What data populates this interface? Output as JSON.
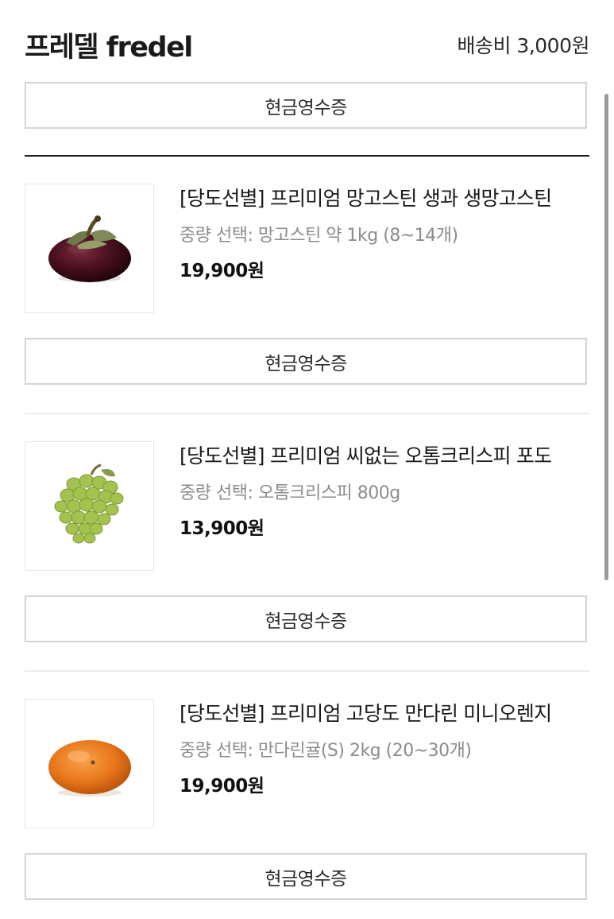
{
  "header": {
    "shop_name": "프레델 fredel",
    "shipping_fee": "배송비 3,000원"
  },
  "receipt_label": "현금영수증",
  "products": [
    {
      "title": "[당도선별] 프리미엄 망고스틴 생과 생망고스틴",
      "option": "중량 선택: 망고스틴 약 1kg (8~14개)",
      "price": "19,900원",
      "image_icon": "mangosteen-icon",
      "receipt_label": "현금영수증"
    },
    {
      "title": "[당도선별] 프리미엄 씨없는 오톰크리스피 포도",
      "option": "중량 선택: 오톰크리스피 800g",
      "price": "13,900원",
      "image_icon": "grape-icon",
      "receipt_label": "현금영수증"
    },
    {
      "title": "[당도선별] 프리미엄 고당도 만다린 미니오렌지",
      "option": "중량 선택: 만다린귤(S) 2kg (20~30개)",
      "price": "19,900원",
      "image_icon": "mandarin-icon",
      "receipt_label": "현금영수증"
    }
  ],
  "colors": {
    "text_primary": "#1a1a1a",
    "text_secondary": "#8c8c8c",
    "button_border": "#d4d4d4",
    "divider_dark": "#1f1f1f",
    "divider_light": "#ececec"
  }
}
